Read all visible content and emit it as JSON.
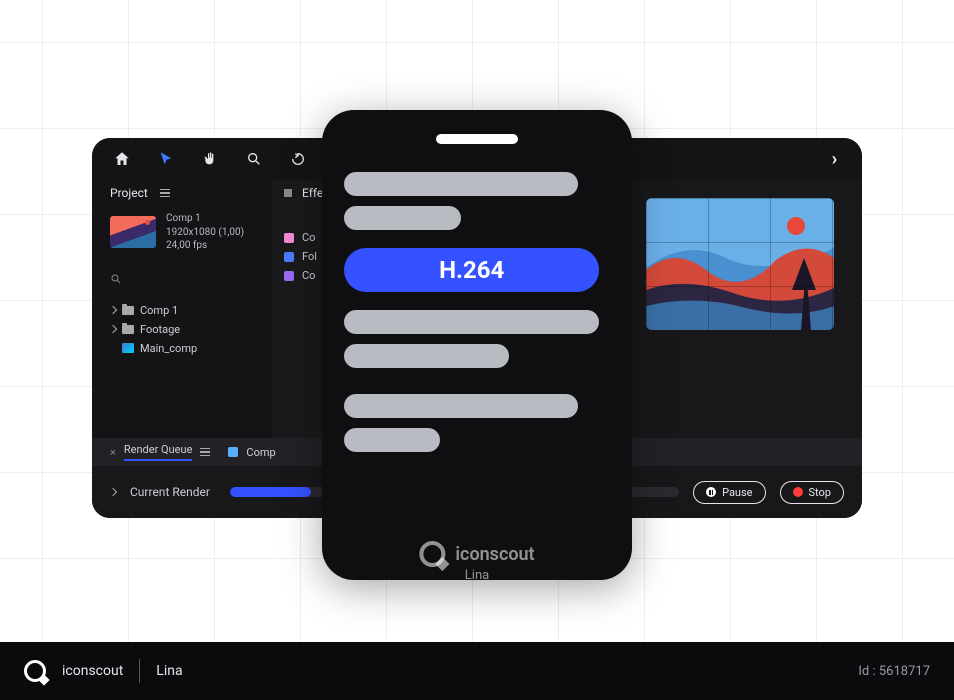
{
  "toolbar": {
    "project_label": "Project",
    "effects_label": "Effe"
  },
  "composition": {
    "name": "Comp 1",
    "resolution": "1920x1080 (1,00)",
    "fps": "24,00 fps"
  },
  "tree": {
    "items": [
      {
        "label": "Comp 1",
        "icon": "folder"
      },
      {
        "label": "Footage",
        "icon": "folder"
      },
      {
        "label": "Main_comp",
        "icon": "image"
      }
    ]
  },
  "mid_items": [
    {
      "label": "Co",
      "swatch": "pink"
    },
    {
      "label": "Fol",
      "swatch": "blue"
    },
    {
      "label": "Co",
      "swatch": "purple"
    }
  ],
  "render": {
    "queue_label": "Render Queue",
    "comp_swatch_label": "Comp",
    "current_label": "Current Render",
    "pause_label": "Pause",
    "stop_label": "Stop"
  },
  "codec": {
    "highlighted": "H.264"
  },
  "watermark": {
    "brand": "iconscout",
    "author": "Lina"
  },
  "footer": {
    "brand": "iconscout",
    "author": "Lina",
    "id_label": "Id : 5618717"
  }
}
